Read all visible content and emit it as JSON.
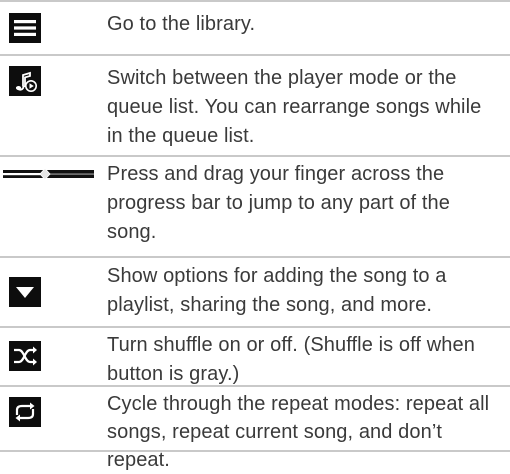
{
  "rows": [
    {
      "icon": "menu-icon",
      "text": "Go to the library."
    },
    {
      "icon": "music-note-play-icon",
      "text": "Switch between the player mode or the queue list. You can rearrange songs while in the queue list."
    },
    {
      "icon": "progress-bar-icon",
      "text": "Press and drag your finger across the progress bar to jump to any part of the song."
    },
    {
      "icon": "dropdown-triangle-icon",
      "text": "Show options for adding the song to a playlist, sharing the song, and more."
    },
    {
      "icon": "shuffle-icon",
      "text": "Turn shuffle on or off. (Shuffle is off when button is gray.)"
    },
    {
      "icon": "repeat-icon",
      "text": "Cycle through the repeat modes: repeat all songs, repeat current song, and don’t repeat."
    }
  ]
}
